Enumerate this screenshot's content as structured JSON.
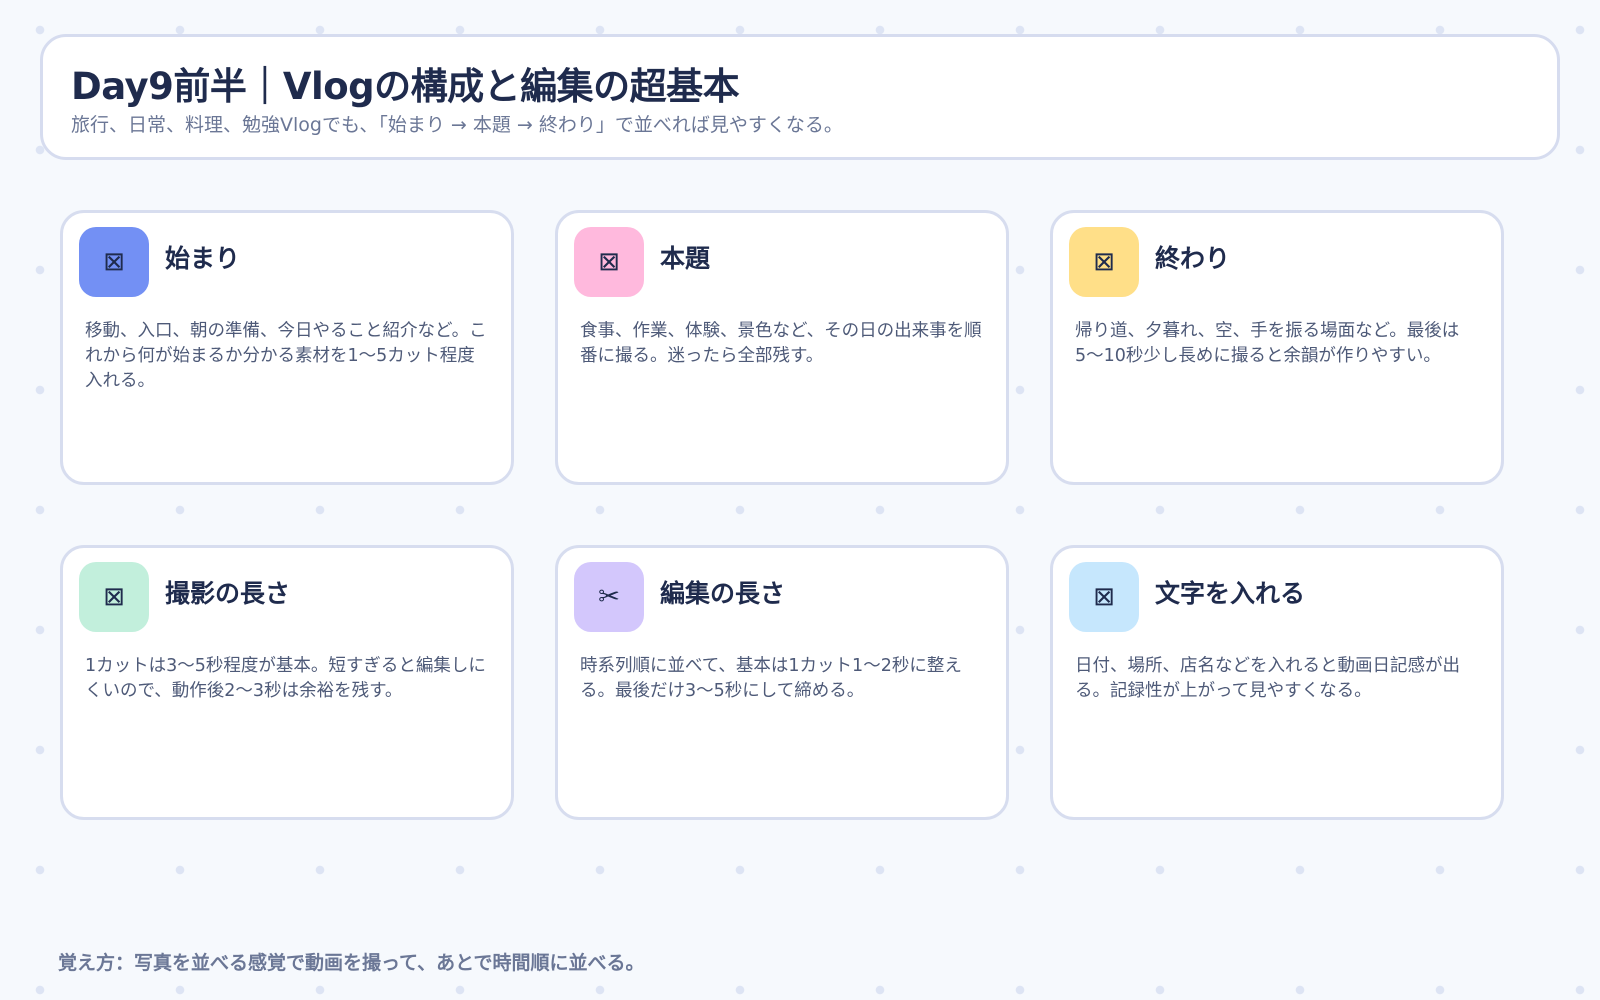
{
  "header": {
    "title": "Day9前半｜Vlogの構成と編集の超基本",
    "subtitle": "旅行、日常、料理、勉強Vlogでも、「始まり → 本題 → 終わり」で並べれば見やすくなる。"
  },
  "cards": [
    {
      "title": "始まり",
      "body": "移動、入口、朝の準備、今日やること紹介など。これから何が始まるか分かる素材を1〜5カット程度入れる。",
      "icon": "image-placeholder-icon",
      "glyph": "⊠",
      "color": "#7390f4"
    },
    {
      "title": "本題",
      "body": "食事、作業、体験、景色など、その日の出来事を順番に撮る。迷ったら全部残す。",
      "icon": "image-placeholder-icon",
      "glyph": "⊠",
      "color": "#ffb9dd"
    },
    {
      "title": "終わり",
      "body": "帰り道、夕暮れ、空、手を振る場面など。最後は5〜10秒少し長めに撮ると余韻が作りやすい。",
      "icon": "image-placeholder-icon",
      "glyph": "⊠",
      "color": "#ffdf88"
    },
    {
      "title": "撮影の長さ",
      "body": "1カットは3〜5秒程度が基本。短すぎると編集しにくいので、動作後2〜3秒は余裕を残す。",
      "icon": "image-placeholder-icon",
      "glyph": "⊠",
      "color": "#c2efdc"
    },
    {
      "title": "編集の長さ",
      "body": "時系列順に並べて、基本は1カット1〜2秒に整える。最後だけ3〜5秒にして締める。",
      "icon": "scissors-icon",
      "glyph": "✂",
      "color": "#d3c7fc"
    },
    {
      "title": "文字を入れる",
      "body": "日付、場所、店名などを入れると動画日記感が出る。記録性が上がって見やすくなる。",
      "icon": "image-placeholder-icon",
      "glyph": "⊠",
      "color": "#c6e7fd"
    }
  ],
  "footer": {
    "text": "覚え方：写真を並べる感覚で動画を撮って、あとで時間順に並べる。"
  }
}
